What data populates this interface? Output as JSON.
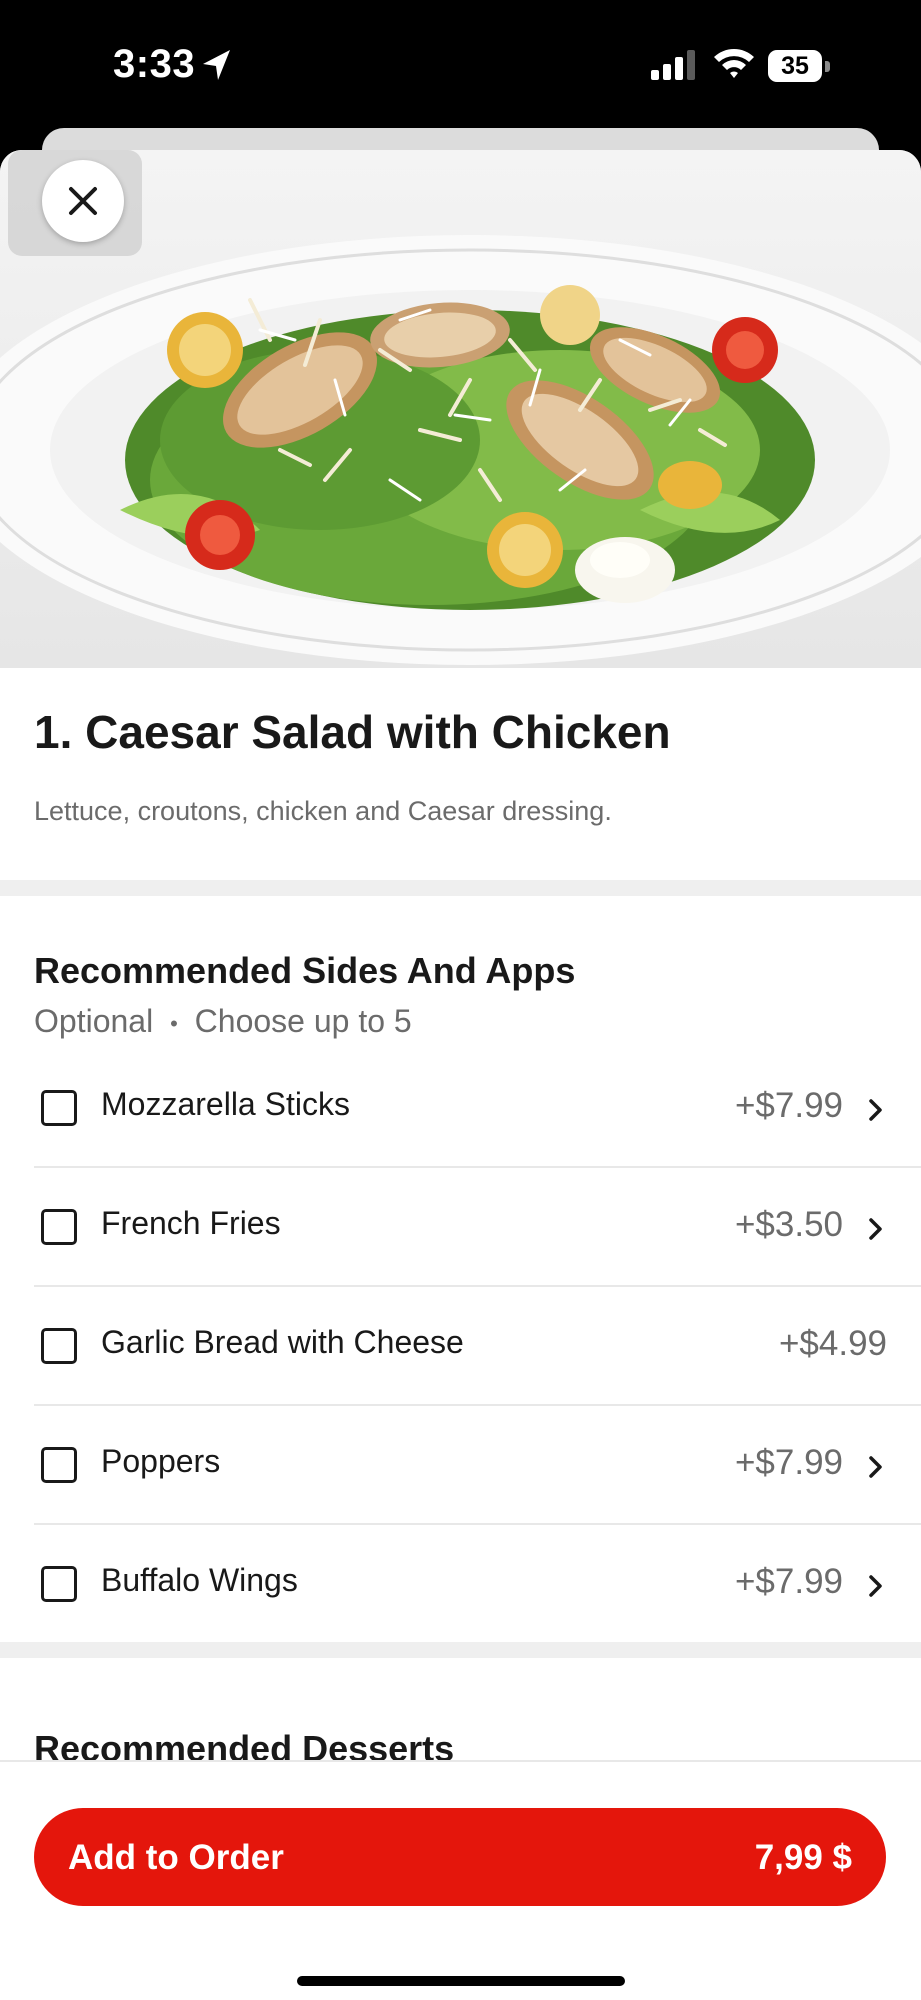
{
  "status_bar": {
    "time": "3:33",
    "battery": "35"
  },
  "close_button": {
    "icon": "close-icon"
  },
  "item": {
    "title": "1. Caesar Salad with Chicken",
    "description": "Lettuce, croutons, chicken and Caesar dressing."
  },
  "sides_section": {
    "title": "Recommended Sides And Apps",
    "optional": "Optional",
    "separator": "•",
    "limit": "Choose up to 5",
    "options": [
      {
        "name": "Mozzarella Sticks",
        "price": "+$7.99",
        "checked": false,
        "has_chevron": true
      },
      {
        "name": "French Fries",
        "price": "+$3.50",
        "checked": false,
        "has_chevron": true
      },
      {
        "name": "Garlic Bread with Cheese",
        "price": "+$4.99",
        "checked": false,
        "has_chevron": false
      },
      {
        "name": "Poppers",
        "price": "+$7.99",
        "checked": false,
        "has_chevron": true
      },
      {
        "name": "Buffalo Wings",
        "price": "+$7.99",
        "checked": false,
        "has_chevron": true
      }
    ]
  },
  "desserts_section": {
    "title": "Recommended Desserts"
  },
  "add_to_order": {
    "label": "Add to Order",
    "price": "7,99 $"
  },
  "colors": {
    "accent": "#e4160c",
    "text": "#191919",
    "muted": "#6b6b6b",
    "divider": "#efefef"
  }
}
